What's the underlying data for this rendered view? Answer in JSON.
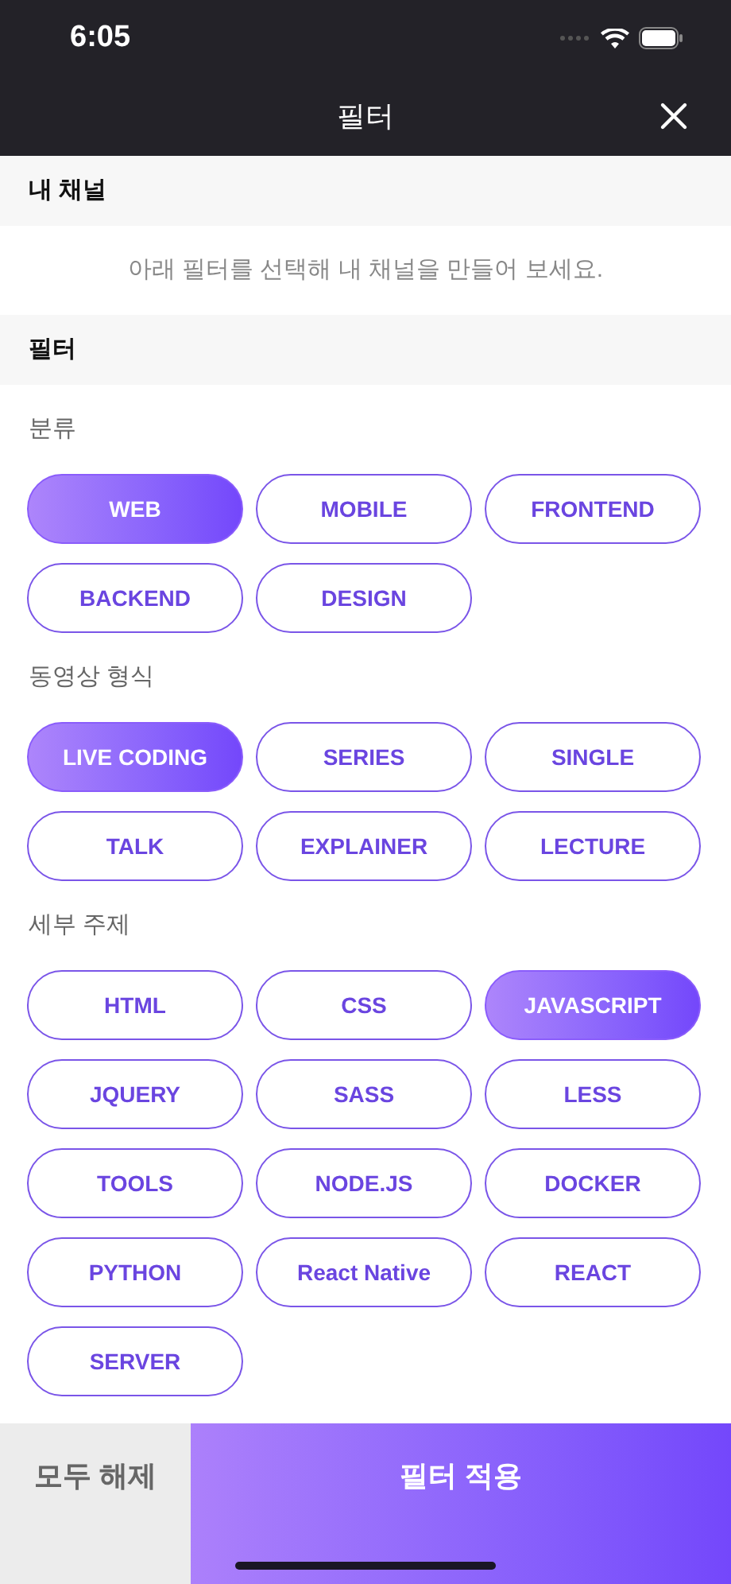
{
  "status_bar": {
    "time": "6:05"
  },
  "nav": {
    "title": "필터"
  },
  "my_channel": {
    "header": "내 채널",
    "message": "아래 필터를 선택해 내 채널을 만들어 보세요."
  },
  "filter": {
    "header": "필터",
    "groups": [
      {
        "label": "분류",
        "chips": [
          {
            "label": "WEB",
            "selected": true
          },
          {
            "label": "MOBILE",
            "selected": false
          },
          {
            "label": "FRONTEND",
            "selected": false
          },
          {
            "label": "BACKEND",
            "selected": false
          },
          {
            "label": "DESIGN",
            "selected": false
          }
        ]
      },
      {
        "label": "동영상 형식",
        "chips": [
          {
            "label": "LIVE CODING",
            "selected": true
          },
          {
            "label": "SERIES",
            "selected": false
          },
          {
            "label": "SINGLE",
            "selected": false
          },
          {
            "label": "TALK",
            "selected": false
          },
          {
            "label": "EXPLAINER",
            "selected": false
          },
          {
            "label": "LECTURE",
            "selected": false
          }
        ]
      },
      {
        "label": "세부 주제",
        "chips": [
          {
            "label": "HTML",
            "selected": false
          },
          {
            "label": "CSS",
            "selected": false
          },
          {
            "label": "JAVASCRIPT",
            "selected": true
          },
          {
            "label": "JQUERY",
            "selected": false
          },
          {
            "label": "SASS",
            "selected": false
          },
          {
            "label": "LESS",
            "selected": false
          },
          {
            "label": "TOOLS",
            "selected": false
          },
          {
            "label": "NODE.JS",
            "selected": false
          },
          {
            "label": "DOCKER",
            "selected": false
          },
          {
            "label": "PYTHON",
            "selected": false
          },
          {
            "label": "React Native",
            "selected": false
          },
          {
            "label": "REACT",
            "selected": false
          },
          {
            "label": "SERVER",
            "selected": false
          }
        ]
      }
    ]
  },
  "footer": {
    "clear_label": "모두 해제",
    "apply_label": "필터 적용"
  }
}
